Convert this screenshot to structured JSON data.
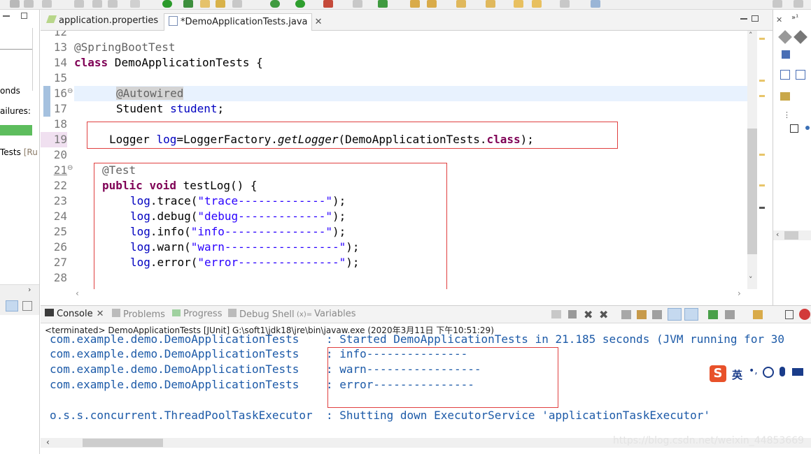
{
  "editor": {
    "tabs": [
      {
        "label": "application.properties"
      },
      {
        "label": "*DemoApplicationTests.java"
      }
    ],
    "lines": [
      {
        "num": "12"
      },
      {
        "num": "13",
        "ann": "@SpringBootTest"
      },
      {
        "num": "14",
        "kw": "class",
        "text": " DemoApplicationTests {"
      },
      {
        "num": "15"
      },
      {
        "num": "16",
        "ann": "@Autowired"
      },
      {
        "num": "17",
        "type": "Student ",
        "field": "student",
        "end": ";"
      },
      {
        "num": "18"
      },
      {
        "num": "19",
        "a": "Logger ",
        "field": "log",
        "b": "=LoggerFactory.",
        "method": "getLogger",
        "c": "(DemoApplicationTests.",
        "kw": "class",
        "d": ");"
      },
      {
        "num": "20"
      },
      {
        "num": "21",
        "ann": "@Test"
      },
      {
        "num": "22",
        "kw1": "public",
        "kw2": "void",
        "text": " testLog() {"
      },
      {
        "num": "23",
        "field": "log",
        "call": ".trace(",
        "str": "\"trace-------------\"",
        "end": ");"
      },
      {
        "num": "24",
        "field": "log",
        "call": ".debug(",
        "str": "\"debug-------------\"",
        "end": ");"
      },
      {
        "num": "25",
        "field": "log",
        "call": ".info(",
        "str": "\"info---------------\"",
        "end": ");"
      },
      {
        "num": "26",
        "field": "log",
        "call": ".warn(",
        "str": "\"warn-----------------\"",
        "end": ");"
      },
      {
        "num": "27",
        "field": "log",
        "call": ".error(",
        "str": "\"error---------------\"",
        "end": ");"
      },
      {
        "num": "28"
      }
    ]
  },
  "left_panel": {
    "fragment1": "onds",
    "fragment2": "ailures:",
    "fragment3": "Tests",
    "fragment4": "[Ru"
  },
  "console": {
    "tabs": [
      {
        "label": "Console"
      },
      {
        "label": "Problems"
      },
      {
        "label": "Progress"
      },
      {
        "label": "Debug Shell"
      },
      {
        "label": "Variables"
      }
    ],
    "header": "<terminated> DemoApplicationTests [JUnit] G:\\soft1\\jdk18\\jre\\bin\\javaw.exe (2020年3月11日 下午10:51:29)",
    "lines": [
      "com.example.demo.DemoApplicationTests    : Started DemoApplicationTests in 21.185 seconds (JVM running for 30",
      "com.example.demo.DemoApplicationTests    : info---------------",
      "com.example.demo.DemoApplicationTests    : warn-----------------",
      "com.example.demo.DemoApplicationTests    : error---------------",
      "",
      "o.s.s.concurrent.ThreadPoolTaskExecutor  : Shutting down ExecutorService 'applicationTaskExecutor'"
    ],
    "ime_label": "英",
    "watermark": "https://blog.csdn.net/weixin_44853669"
  },
  "colors": {
    "keyword": "#7f0055",
    "annotation": "#646464",
    "field": "#0000c0",
    "string": "#2a00ff",
    "console_text": "#1c5aa8",
    "highlight_box": "#e04040"
  }
}
